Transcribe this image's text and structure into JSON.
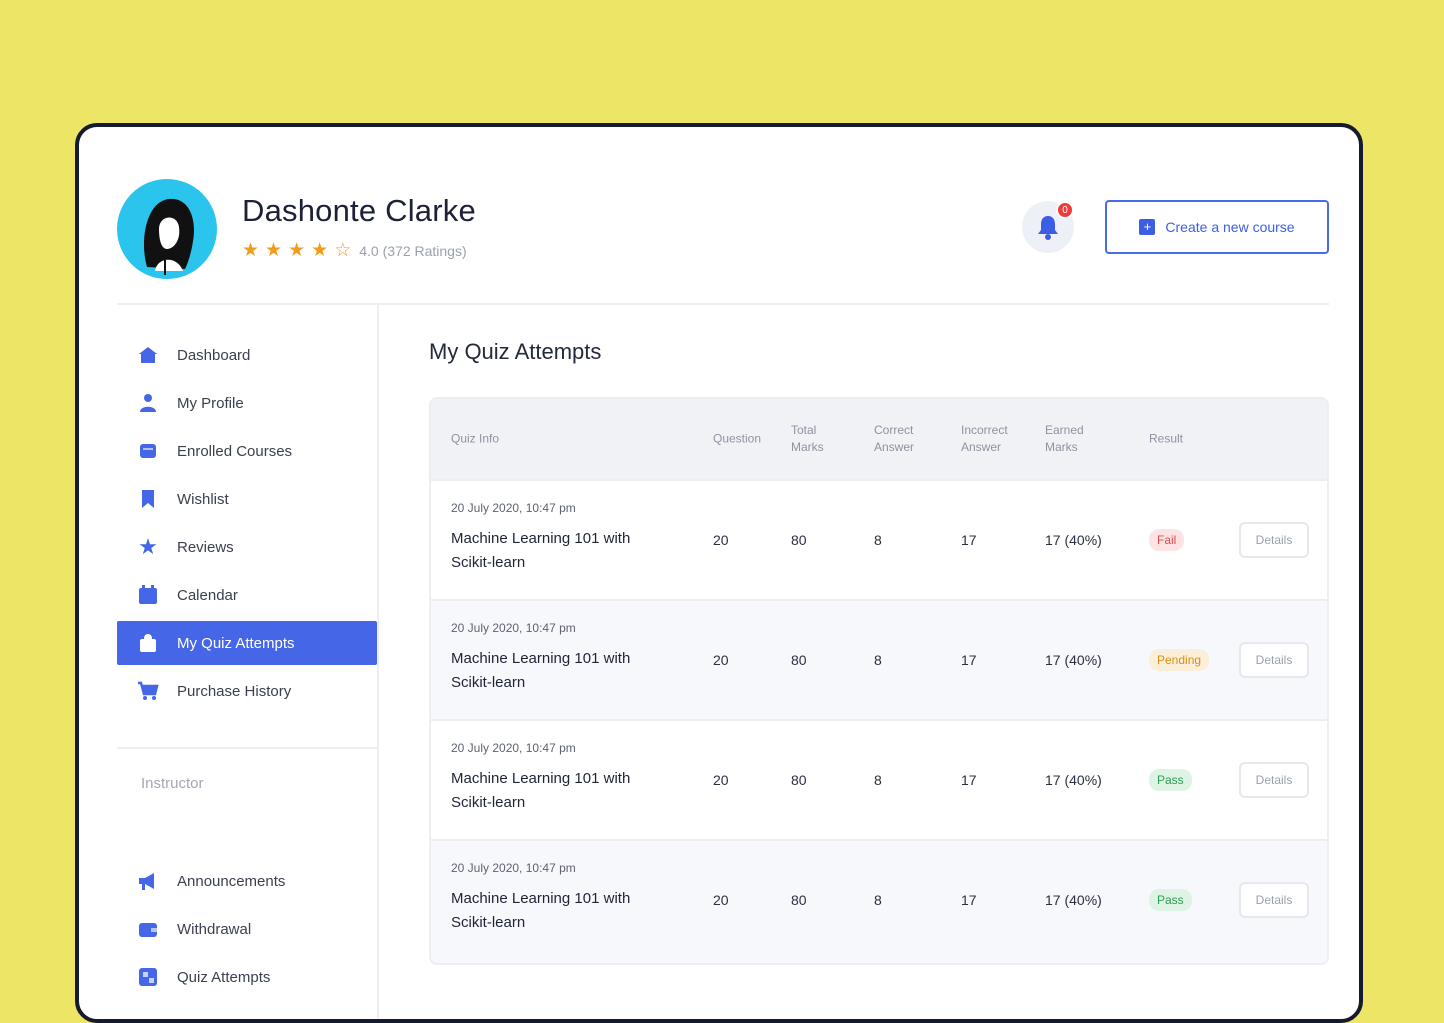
{
  "profile": {
    "name": "Dashonte Clarke",
    "rating_text": "4.0 (372 Ratings)",
    "stars": [
      true,
      true,
      true,
      true,
      false
    ]
  },
  "notifications": {
    "count": "0"
  },
  "header": {
    "create_button": "Create a new course"
  },
  "sidebar": {
    "items": [
      {
        "label": "Dashboard",
        "icon": "home-icon"
      },
      {
        "label": "My Profile",
        "icon": "user-icon"
      },
      {
        "label": "Enrolled Courses",
        "icon": "book-icon"
      },
      {
        "label": "Wishlist",
        "icon": "bookmark-icon"
      },
      {
        "label": "Reviews",
        "icon": "star-icon"
      },
      {
        "label": "Calendar",
        "icon": "calendar-icon"
      },
      {
        "label": "My Quiz Attempts",
        "icon": "quiz-icon",
        "active": true
      },
      {
        "label": "Purchase History",
        "icon": "cart-icon"
      }
    ],
    "section_label": "Instructor",
    "instructor_items": [
      {
        "label": "Announcements",
        "icon": "megaphone-icon"
      },
      {
        "label": "Withdrawal",
        "icon": "wallet-icon"
      },
      {
        "label": "Quiz Attempts",
        "icon": "quiz-icon"
      }
    ]
  },
  "main": {
    "title": "My Quiz Attempts",
    "columns": {
      "quiz_info": "Quiz Info",
      "question": "Question",
      "total_marks": "Total Marks",
      "correct_answer": "Correct Answer",
      "incorrect_answer": "Incorrect Answer",
      "earned_marks": "Earned Marks",
      "result": "Result"
    },
    "rows": [
      {
        "date": "20 July 2020, 10:47 pm",
        "title": "Machine Learning 101 with Scikit-learn",
        "question": "20",
        "total_marks": "80",
        "correct": "8",
        "incorrect": "17",
        "earned": "17 (40%)",
        "result": "Fail",
        "result_type": "fail",
        "details": "Details"
      },
      {
        "date": "20 July 2020, 10:47 pm",
        "title": "Machine Learning 101 with Scikit-learn",
        "question": "20",
        "total_marks": "80",
        "correct": "8",
        "incorrect": "17",
        "earned": "17 (40%)",
        "result": "Pending",
        "result_type": "pending",
        "details": "Details"
      },
      {
        "date": "20 July 2020, 10:47 pm",
        "title": "Machine Learning 101 with Scikit-learn",
        "question": "20",
        "total_marks": "80",
        "correct": "8",
        "incorrect": "17",
        "earned": "17 (40%)",
        "result": "Pass",
        "result_type": "pass",
        "details": "Details"
      },
      {
        "date": "20 July 2020, 10:47 pm",
        "title": "Machine Learning 101 with Scikit-learn",
        "question": "20",
        "total_marks": "80",
        "correct": "8",
        "incorrect": "17",
        "earned": "17 (40%)",
        "result": "Pass",
        "result_type": "pass",
        "details": "Details"
      }
    ]
  },
  "colors": {
    "accent": "#4566e6",
    "background": "#ECE565",
    "star": "#f29c1f"
  }
}
